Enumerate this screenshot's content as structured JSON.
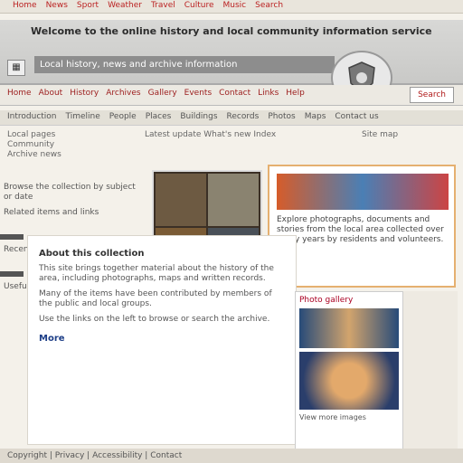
{
  "top_nav": [
    "Home",
    "News",
    "Sport",
    "Weather",
    "Travel",
    "Culture",
    "Music",
    "Search"
  ],
  "header": {
    "title": "Welcome to the online history and local community information service",
    "subtitle": "Local history, news and archive information",
    "logo_icon": "crest-icon",
    "menu_icon": "grid-icon"
  },
  "toolbar": {
    "links": [
      "Home",
      "About",
      "History",
      "Archives",
      "Gallery",
      "Events",
      "Contact",
      "Links",
      "Help"
    ],
    "search_label": "Search"
  },
  "subnav": [
    "Introduction",
    "Timeline",
    "People",
    "Places",
    "Buildings",
    "Records",
    "Photos",
    "Maps",
    "Contact us"
  ],
  "sub2": {
    "left": "Local pages\nCommunity\nArchive news",
    "mid": "Latest update   What's new   Index",
    "right": "Site map"
  },
  "sidebar": {
    "blocks": [
      "Browse the collection by subject or date",
      "Related items and links",
      "Recently added pages",
      "Useful resources"
    ]
  },
  "feature": {
    "text": "Explore photographs, documents and stories from the local area collected over many years by residents and volunteers."
  },
  "article": {
    "heading": "About this collection",
    "paras": [
      "This site brings together material about the history of the area, including photographs, maps and written records.",
      "Many of the items have been contributed by members of the public and local groups.",
      "Use the links on the left to browse or search the archive."
    ],
    "link": "More"
  },
  "photos": {
    "caption": "Photo gallery",
    "photo_caption": "View more images"
  },
  "footer": "Copyright | Privacy | Accessibility | Contact"
}
